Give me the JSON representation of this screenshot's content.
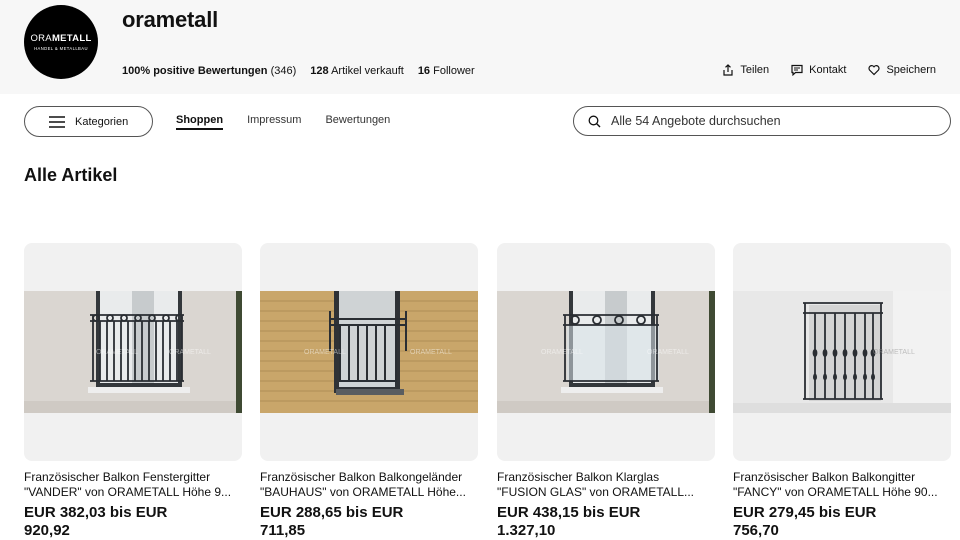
{
  "store": {
    "logo_text_light": "ORA",
    "logo_text_bold": "METALL",
    "logo_subtitle": "HANDEL & METALLBAU",
    "name": "orametall",
    "positive": "100% positive Bewertungen",
    "positive_count": "(346)",
    "sold_count": "128",
    "sold_label": "Artikel verkauft",
    "follower_count": "16",
    "follower_label": "Follower"
  },
  "actions": {
    "share": "Teilen",
    "contact": "Kontakt",
    "save": "Speichern"
  },
  "nav": {
    "categories": "Kategorien",
    "tabs": [
      "Shoppen",
      "Impressum",
      "Bewertungen"
    ],
    "search_placeholder": "Alle 54 Angebote durchsuchen"
  },
  "section_title": "Alle Artikel",
  "watermark": "ORAMETALL",
  "products": [
    {
      "title_line1": "Französischer Balkon Fenstergitter",
      "title_line2": "\"VANDER\" von ORAMETALL Höhe 9...",
      "price_line1": "EUR 382,03 bis EUR",
      "price_line2": "920,92"
    },
    {
      "title_line1": "Französischer Balkon Balkongeländer",
      "title_line2": "\"BAUHAUS\" von ORAMETALL Höhe...",
      "price_line1": "EUR 288,65 bis EUR",
      "price_line2": "711,85"
    },
    {
      "title_line1": "Französischer Balkon Klarglas",
      "title_line2": "\"FUSION GLAS\" von ORAMETALL...",
      "price_line1": "EUR 438,15 bis EUR",
      "price_line2": "1.327,10"
    },
    {
      "title_line1": "Französischer Balkon Balkongitter",
      "title_line2": "\"FANCY\" von ORAMETALL Höhe 90...",
      "price_line1": "EUR 279,45 bis EUR",
      "price_line2": "756,70"
    }
  ],
  "colors": {
    "header_bg": "#f7f7f7",
    "logo_bg": "#000000",
    "card_bg": "#f1f1f1",
    "railing": "#2a2e33"
  }
}
